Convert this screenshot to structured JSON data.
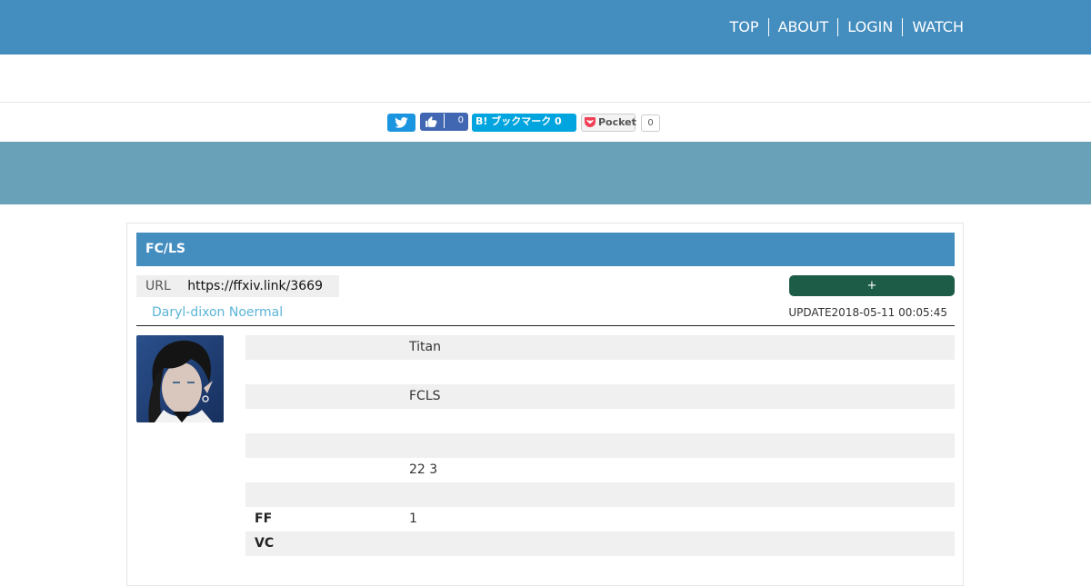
{
  "nav": [
    "TOP",
    "ABOUT",
    "LOGIN",
    "WATCH"
  ],
  "share": {
    "facebook_count": "0",
    "hatena_label": "B! ブックマーク 0",
    "pocket_label": "Pocket",
    "pocket_count": "0"
  },
  "card": {
    "title": "FC/LS",
    "url_label": "URL",
    "url_value": "https://ffxiv.link/3669",
    "add_button": "+",
    "character_name": "Daryl-dixon Noermal",
    "update_text": "UPDATE2018-05-11 00:05:45"
  },
  "rows": [
    {
      "key": "",
      "value": "Titan"
    },
    {
      "key": "",
      "value": ""
    },
    {
      "key": "",
      "value": "FCLS"
    },
    {
      "key": "",
      "value": ""
    },
    {
      "key": "",
      "value": ""
    },
    {
      "key": "",
      "value": "22  3"
    },
    {
      "key": "",
      "value": ""
    },
    {
      "key": "FF",
      "value": "1"
    },
    {
      "key": "VC",
      "value": ""
    }
  ],
  "colors": {
    "header": "#448dbf",
    "band": "#69a1b8",
    "add_button": "#1d5c47",
    "link": "#5bb5d8"
  }
}
